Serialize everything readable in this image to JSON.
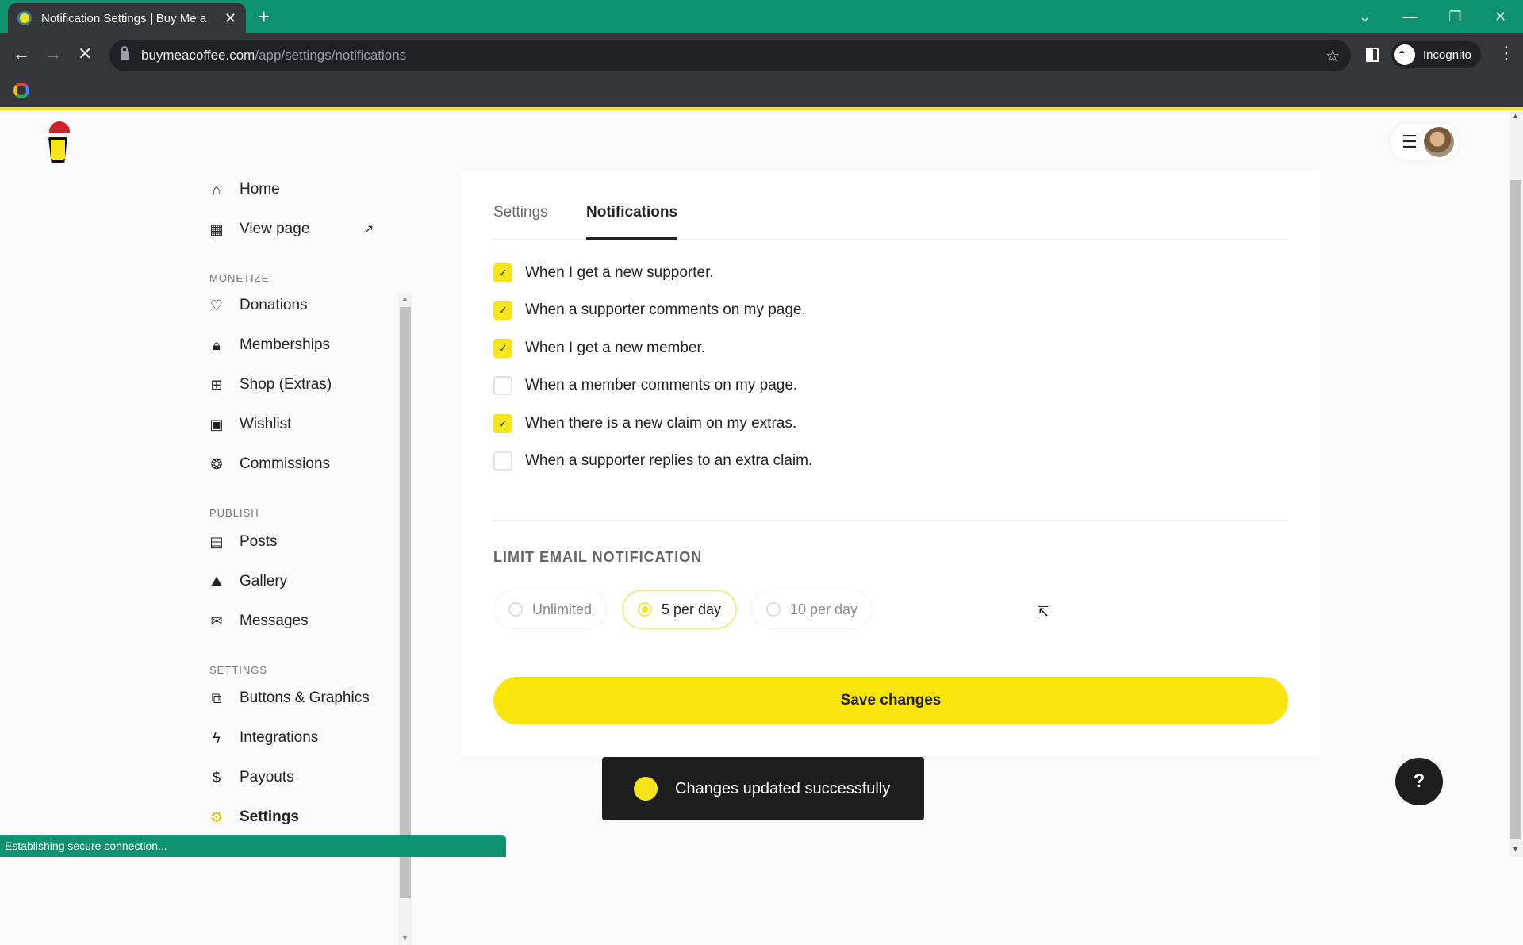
{
  "browser": {
    "tab_title": "Notification Settings | Buy Me a",
    "url_host": "buymeacoffee.com",
    "url_path": "/app/settings/notifications",
    "profile_label": "Incognito",
    "status_text": "Establishing secure connection..."
  },
  "sidebar": {
    "top_items": [
      {
        "label": "Home",
        "icon": "home-icon"
      },
      {
        "label": "View page",
        "icon": "layout-icon"
      }
    ],
    "sections": [
      {
        "label": "MONETIZE",
        "items": [
          {
            "label": "Donations",
            "icon": "heart-icon"
          },
          {
            "label": "Memberships",
            "icon": "lock-icon"
          },
          {
            "label": "Shop (Extras)",
            "icon": "gift-icon"
          },
          {
            "label": "Wishlist",
            "icon": "wishlist-icon"
          },
          {
            "label": "Commissions",
            "icon": "handshake-icon"
          }
        ]
      },
      {
        "label": "PUBLISH",
        "items": [
          {
            "label": "Posts",
            "icon": "document-icon"
          },
          {
            "label": "Gallery",
            "icon": "image-icon"
          },
          {
            "label": "Messages",
            "icon": "mail-icon"
          }
        ]
      },
      {
        "label": "SETTINGS",
        "items": [
          {
            "label": "Buttons & Graphics",
            "icon": "code-window-icon"
          },
          {
            "label": "Integrations",
            "icon": "lightning-icon"
          },
          {
            "label": "Payouts",
            "icon": "dollar-icon"
          },
          {
            "label": "Settings",
            "icon": "gear-icon",
            "active": true
          }
        ]
      }
    ]
  },
  "main": {
    "tabs": [
      {
        "label": "Settings",
        "active": false
      },
      {
        "label": "Notifications",
        "active": true
      }
    ],
    "notifications": [
      {
        "label": "When I get a new supporter.",
        "checked": true
      },
      {
        "label": "When a supporter comments on my page.",
        "checked": true
      },
      {
        "label": "When I get a new member.",
        "checked": true
      },
      {
        "label": "When a member comments on my page.",
        "checked": false
      },
      {
        "label": "When there is a new claim on my extras.",
        "checked": true
      },
      {
        "label": "When a supporter replies to an extra claim.",
        "checked": false
      }
    ],
    "limit_label": "LIMIT EMAIL NOTIFICATION",
    "limit_options": [
      {
        "label": "Unlimited",
        "selected": false
      },
      {
        "label": "5 per day",
        "selected": true
      },
      {
        "label": "10 per day",
        "selected": false
      }
    ],
    "save_label": "Save changes"
  },
  "toast": {
    "message": "Changes updated successfully"
  },
  "help_label": "?",
  "colors": {
    "brand_yellow": "#f9e40b",
    "chrome_green": "#0e9270",
    "toast_bg": "#1e1e1f"
  }
}
